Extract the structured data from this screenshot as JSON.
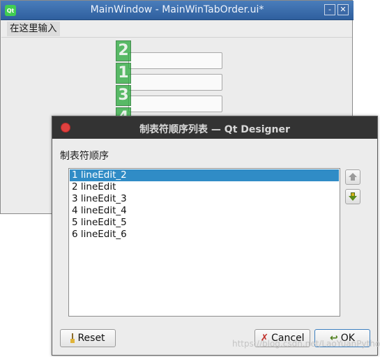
{
  "main_window": {
    "title": "MainWindow - MainWinTabOrder.ui*",
    "logo_text": "Qt",
    "minimize_label": "-",
    "close_label": "✕",
    "menubar": {
      "item_label": "在这里输入"
    },
    "tab_order_badges": [
      "2",
      "1",
      "3",
      "4"
    ]
  },
  "dialog": {
    "title": "制表符顺序列表 — Qt Designer",
    "group_label": "制表符顺序",
    "items": [
      "1 lineEdit_2",
      "2 lineEdit",
      "3 lineEdit_3",
      "4 lineEdit_4",
      "5 lineEdit_5",
      "6 lineEdit_6"
    ],
    "selected_index": 0,
    "buttons": {
      "reset": "Reset",
      "cancel": "Cancel",
      "ok": "OK"
    }
  },
  "watermark": "https://blog.csdn.net/LaoYuanPython",
  "colors": {
    "selection": "#308cc6",
    "badge": "#27a83a",
    "dialog_titlebar": "#333333",
    "close_dot": "#e0413f"
  }
}
